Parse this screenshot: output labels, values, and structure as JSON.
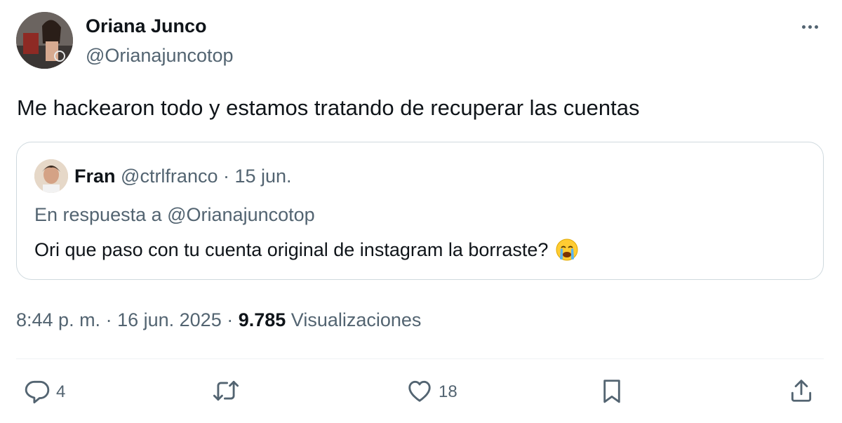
{
  "author": {
    "name": "Oriana Junco",
    "handle": "@Orianajuncotop"
  },
  "tweet": {
    "text": "Me hackearon todo y estamos tratando de recuperar las cuentas"
  },
  "quote": {
    "name": "Fran",
    "handle": "@ctrlfranco",
    "separator": " · ",
    "date": "15 jun.",
    "reply_to": "En respuesta a @Orianajuncotop",
    "text": "Ori que paso con tu cuenta original de instagram la borraste?",
    "emoji": "loudly-crying-face"
  },
  "meta": {
    "time": "8:44 p. m.",
    "separator": " · ",
    "date": "16 jun. 2025",
    "views_count": "9.785",
    "views_label": " Visualizaciones"
  },
  "actions": {
    "reply_count": "4",
    "like_count": "18"
  },
  "icons": {
    "reply": "reply-icon",
    "retweet": "retweet-icon",
    "like": "heart-icon",
    "bookmark": "bookmark-icon",
    "share": "share-icon",
    "more": "more-icon"
  },
  "colors": {
    "text": "#0f1419",
    "secondary": "#536471",
    "border": "#cfd9de"
  }
}
